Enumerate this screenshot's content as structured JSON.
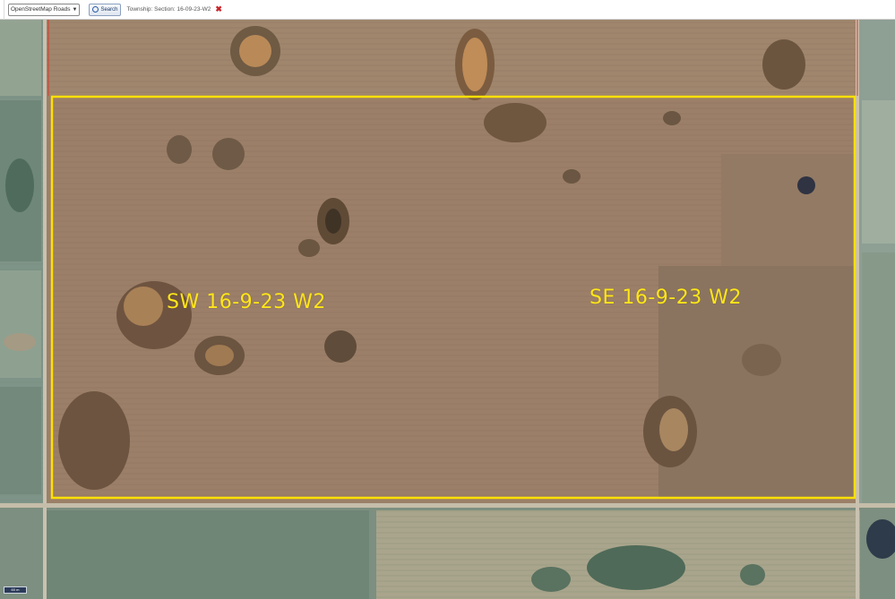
{
  "toolbar": {
    "layer_selected": "OpenStreetMap Roads",
    "search_label": "Search",
    "township_text": "Township: Section: 16-09-23-W2"
  },
  "map": {
    "parcels": [
      {
        "label": "SW 16-9-23 W2"
      },
      {
        "label": "SE 16-9-23 W2"
      }
    ],
    "boundary_color": "#ffe000",
    "scale_label": "60 m"
  },
  "icons": {
    "search": "search-icon",
    "close": "close-icon",
    "caret": "chevron-down-icon"
  }
}
